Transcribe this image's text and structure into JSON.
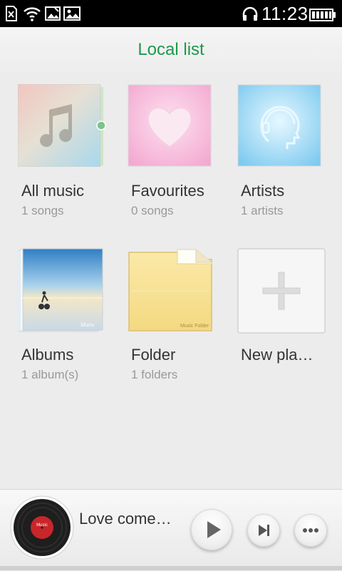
{
  "status_bar": {
    "time": "11:23",
    "icons": [
      "sim-card-error-icon",
      "wifi-icon",
      "image-notification-icon",
      "picture-notification-icon",
      "headphones-icon",
      "battery-icon"
    ]
  },
  "header": {
    "title": "Local list"
  },
  "grid": {
    "items": [
      {
        "label": "All music",
        "sub": "1 songs",
        "icon": "music-note-icon"
      },
      {
        "label": "Favourites",
        "sub": "0 songs",
        "icon": "heart-icon"
      },
      {
        "label": "Artists",
        "sub": "1 artists",
        "icon": "artist-headphones-icon"
      },
      {
        "label": "Albums",
        "sub": "1 album(s)",
        "icon": "album-photo-icon",
        "art_text": "Music"
      },
      {
        "label": "Folder",
        "sub": "1  folders",
        "icon": "folder-icon",
        "art_text": "Music  Folder"
      },
      {
        "label": "New pla…",
        "sub": "",
        "icon": "plus-icon"
      }
    ]
  },
  "player": {
    "track_title": "Love come…",
    "disc_label": "Music",
    "colors": {
      "accent": "#1b9a4e",
      "disc_red": "#c8262b"
    }
  }
}
